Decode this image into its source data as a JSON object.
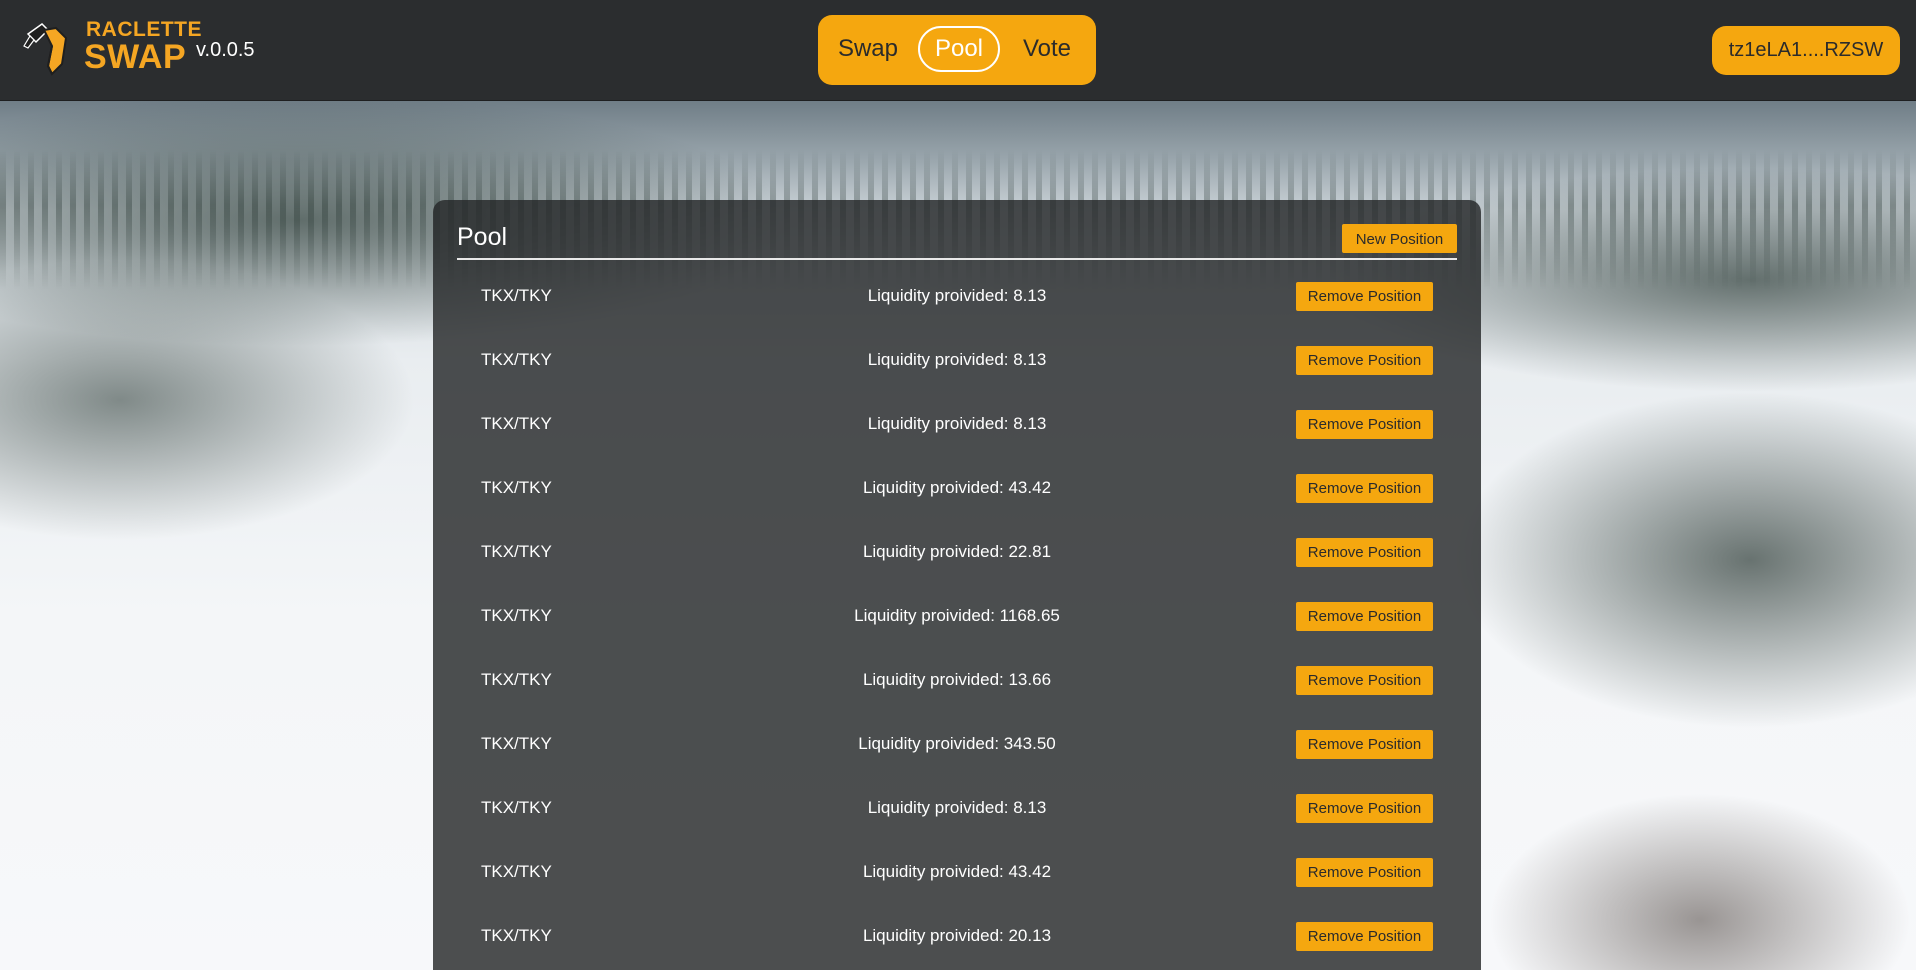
{
  "header": {
    "logo_line1": "RACLETTE",
    "logo_line2": "SWAP",
    "version": "v.0.0.5",
    "nav": {
      "swap": "Swap",
      "pool": "Pool",
      "vote": "Vote",
      "active": "Pool"
    },
    "wallet_address": "tz1eLA1....RZSW"
  },
  "pool": {
    "title": "Pool",
    "new_position_label": "New Position",
    "remove_label": "Remove Position",
    "rows": [
      {
        "pair": "TKX/TKY",
        "liquidity": "Liquidity proivided: 8.13"
      },
      {
        "pair": "TKX/TKY",
        "liquidity": "Liquidity proivided: 8.13"
      },
      {
        "pair": "TKX/TKY",
        "liquidity": "Liquidity proivided: 8.13"
      },
      {
        "pair": "TKX/TKY",
        "liquidity": "Liquidity proivided: 43.42"
      },
      {
        "pair": "TKX/TKY",
        "liquidity": "Liquidity proivided: 22.81"
      },
      {
        "pair": "TKX/TKY",
        "liquidity": "Liquidity proivided: 1168.65"
      },
      {
        "pair": "TKX/TKY",
        "liquidity": "Liquidity proivided: 13.66"
      },
      {
        "pair": "TKX/TKY",
        "liquidity": "Liquidity proivided: 343.50"
      },
      {
        "pair": "TKX/TKY",
        "liquidity": "Liquidity proivided: 8.13"
      },
      {
        "pair": "TKX/TKY",
        "liquidity": "Liquidity proivided: 43.42"
      },
      {
        "pair": "TKX/TKY",
        "liquidity": "Liquidity proivided: 20.13"
      }
    ]
  },
  "colors": {
    "accent": "#f5a70f",
    "header_bg": "#2b2d2f",
    "panel_bg": "#26282a"
  },
  "icons": {
    "logo": "raclette-knife-icon"
  }
}
